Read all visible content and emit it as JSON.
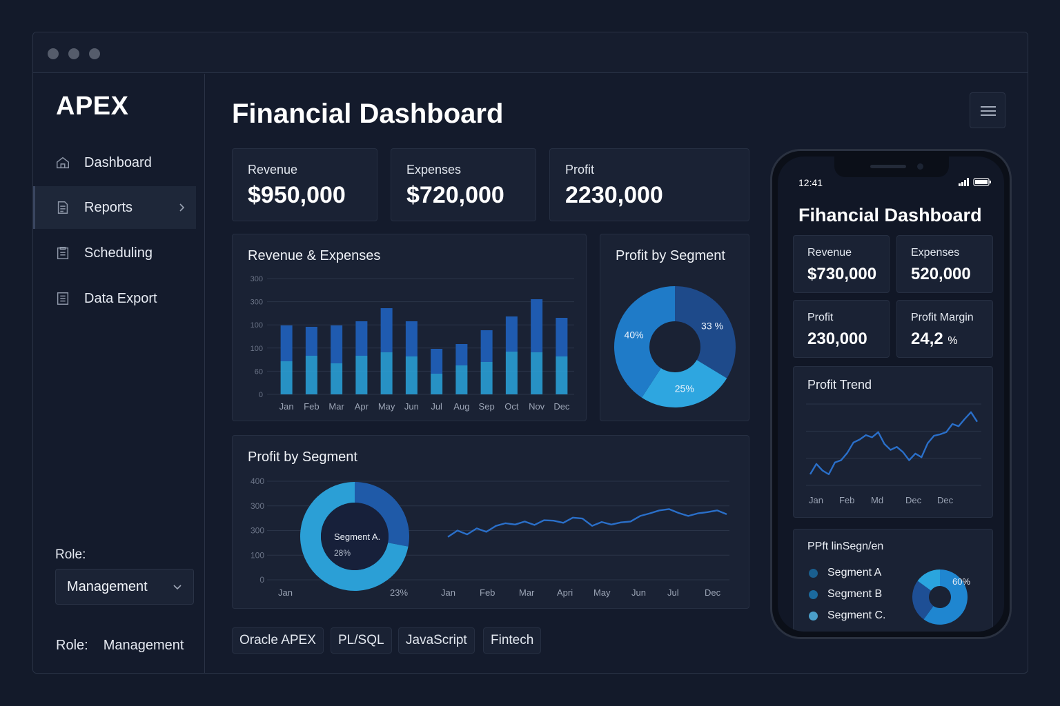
{
  "sidebar": {
    "logo": "APEX",
    "items": [
      {
        "label": "Dashboard"
      },
      {
        "label": "Reports"
      },
      {
        "label": "Scheduling"
      },
      {
        "label": "Data Export"
      }
    ],
    "role_label": "Role:",
    "role_value": "Management",
    "role_footer_label": "Role:",
    "role_footer_value": "Management"
  },
  "header": {
    "title": "Financial Dashboard"
  },
  "kpis": [
    {
      "label": "Revenue",
      "value": "$950,000"
    },
    {
      "label": "Expenses",
      "value": "$720,000"
    },
    {
      "label": "Profit",
      "value": "2230,000"
    }
  ],
  "rev_exp_card": {
    "title": "Revenue & Expenses"
  },
  "segment_donut_card": {
    "title": "Profit by Segment"
  },
  "segment_line_card": {
    "title": "Profit by Segment"
  },
  "tags": [
    "Oracle APEX",
    "PL/SQL",
    "JavaScript",
    "Fintech"
  ],
  "phone": {
    "time": "12:41",
    "title": "Fihancial Dashboard",
    "kpis": [
      {
        "label": "Revenue",
        "value": "$730,000"
      },
      {
        "label": "Expenses",
        "value": "520,000"
      },
      {
        "label": "Profit",
        "value": "230,000"
      },
      {
        "label": "Profit Margin",
        "value": "24,2",
        "unit": "%"
      }
    ],
    "trend_title": "Profit Trend",
    "segment_title": "PPft linSegn/en",
    "legend": [
      {
        "label": "Segment A",
        "color": "#1a5f8f"
      },
      {
        "label": "Segment B",
        "color": "#1b6a9e"
      },
      {
        "label": "Segment C.",
        "color": "#4a9ec8"
      }
    ]
  },
  "colors": {
    "accent_dark": "#1f5bb0",
    "accent_mid": "#1f86d0",
    "accent_light": "#2aa5de",
    "line": "#2a6fc9"
  },
  "chart_data": [
    {
      "type": "bar",
      "title": "Revenue & Expenses",
      "categories": [
        "Jan",
        "Feb",
        "Mar",
        "Apr",
        "May",
        "Jun",
        "Jul",
        "Aug",
        "Sep",
        "Oct",
        "Nov",
        "Dec"
      ],
      "y_tick_labels": [
        "300",
        "300",
        "100",
        "100",
        "60",
        "0"
      ],
      "series": [
        {
          "values": [
            48,
            56,
            45,
            56,
            61,
            55,
            30,
            42,
            47,
            62,
            61,
            55
          ]
        },
        {
          "values": [
            52,
            42,
            55,
            50,
            64,
            51,
            36,
            31,
            46,
            51,
            77,
            56
          ]
        }
      ],
      "ylim": [
        0,
        168
      ],
      "stacked": true,
      "grid": true
    },
    {
      "type": "pie",
      "title": "Profit by Segment",
      "donut": true,
      "slices": [
        {
          "label": "33 %",
          "value": 33
        },
        {
          "label": "25%",
          "value": 25
        },
        {
          "label": "40%",
          "value": 40
        }
      ]
    },
    {
      "type": "pie",
      "title": "Profit by Segment",
      "donut": true,
      "center_label": "Segment A.",
      "center_value": "28%",
      "slices": [
        {
          "value": 28
        },
        {
          "value": 72
        }
      ],
      "x_label_left": "Jan",
      "x_label_right": "23%"
    },
    {
      "type": "line",
      "title": "Profit by Segment",
      "y_tick_labels": [
        "400",
        "300",
        "300",
        "100",
        "0"
      ],
      "categories": [
        "Jan",
        "Feb",
        "Mar",
        "Apri",
        "May",
        "Jun",
        "Jul",
        "Dec"
      ],
      "values": [
        100,
        115,
        106,
        120,
        112,
        126,
        132,
        129,
        136,
        128,
        139,
        138,
        133,
        145,
        143,
        126,
        135,
        129,
        134,
        136,
        149,
        155,
        162,
        165,
        156,
        149,
        155,
        158,
        162,
        153
      ],
      "ylim": [
        0,
        230
      ],
      "grid": true
    },
    {
      "type": "line",
      "title": "Profit Trend",
      "categories": [
        "Jan",
        "Feb",
        "Md",
        "Dec",
        "Dec"
      ],
      "values": [
        15,
        29,
        20,
        15,
        31,
        34,
        44,
        58,
        62,
        68,
        65,
        72,
        56,
        48,
        52,
        45,
        34,
        43,
        38,
        57,
        67,
        69,
        72,
        83,
        80,
        90,
        99,
        86
      ],
      "ylim": [
        0,
        110
      ],
      "grid": true
    },
    {
      "type": "pie",
      "title": "PPft linSegn/en",
      "donut": true,
      "slices": [
        {
          "label": "60%",
          "value": 60
        },
        {
          "value": 25
        },
        {
          "value": 15
        }
      ]
    }
  ]
}
